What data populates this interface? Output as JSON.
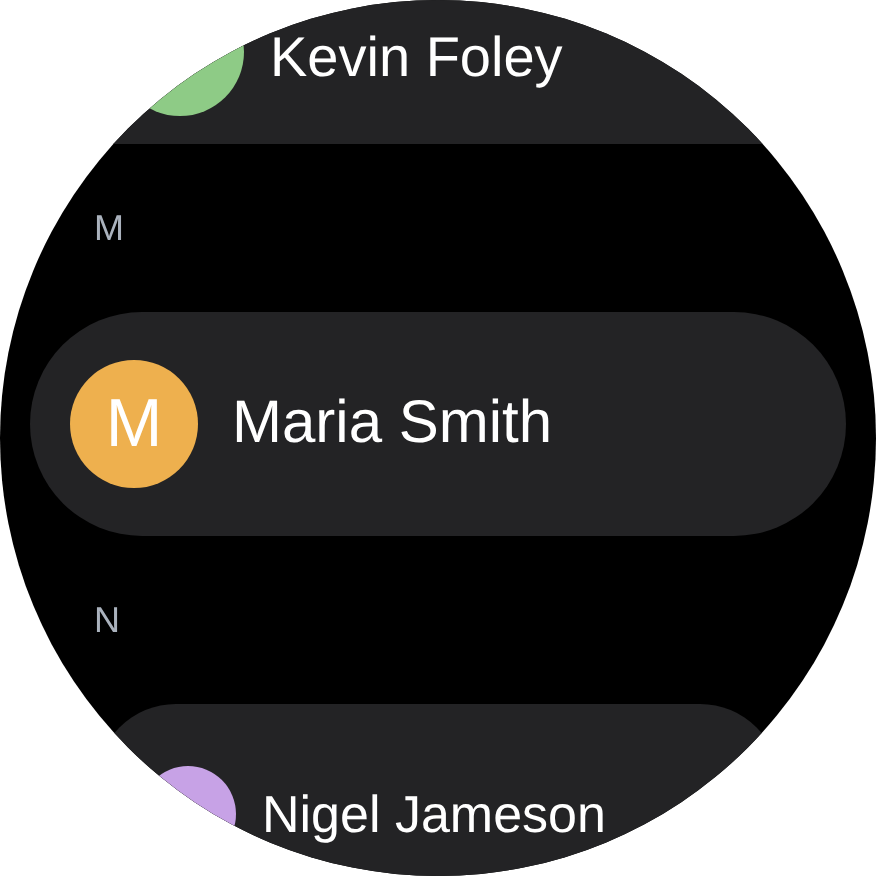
{
  "contacts": [
    {
      "kind": "contact",
      "name": "Kevin Foley",
      "color": "#8ecb86"
    },
    {
      "kind": "header",
      "letter": "M"
    },
    {
      "kind": "contact",
      "name": "Maria Smith",
      "initial": "M",
      "color": "#eeb04e"
    },
    {
      "kind": "header",
      "letter": "N"
    },
    {
      "kind": "contact",
      "name": "Nigel Jameson",
      "color": "#c7a2e6"
    }
  ]
}
